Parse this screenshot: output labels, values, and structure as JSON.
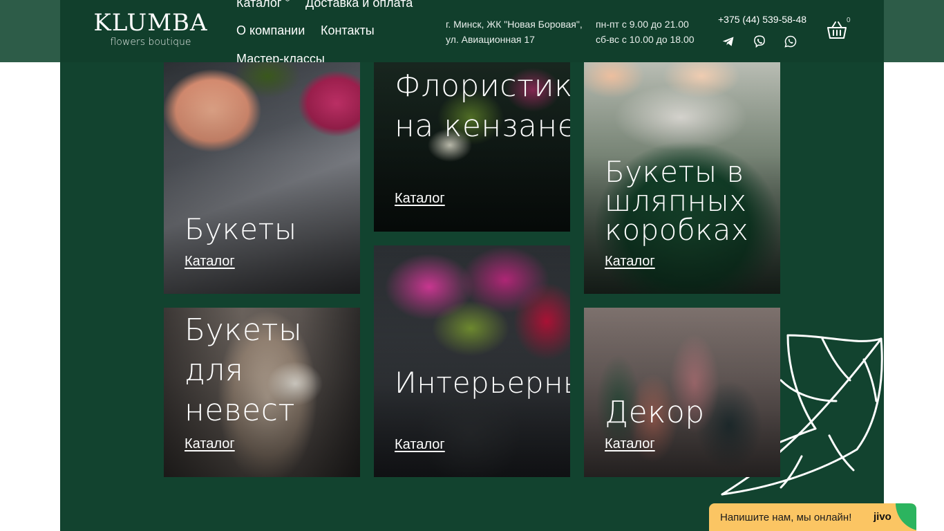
{
  "header": {
    "logo": {
      "main": "KLUMBA",
      "sub": "flowers boutique"
    },
    "nav": [
      {
        "label": "Каталог"
      },
      {
        "label": "Доставка и оплата"
      },
      {
        "label": "О компании"
      },
      {
        "label": "Контакты"
      },
      {
        "label": "Мастер-классы"
      }
    ],
    "address": {
      "line1": "г. Минск, ЖК \"Новая Боровая\",",
      "line2": "ул. Авиационная 17"
    },
    "hours": {
      "line1": "пн-пт с 9.00 до 21.00",
      "line2": "сб-вс с 10.00 до 18.00"
    },
    "phone": "+375 (44) 539-58-48",
    "socials": [
      "telegram-icon",
      "viber-icon",
      "whatsapp-icon"
    ],
    "cart": {
      "icon": "basket-icon",
      "count": "0"
    }
  },
  "categories": [
    {
      "title": "Букеты",
      "link": "Каталог"
    },
    {
      "title": "Флористика на кензане",
      "link": "Каталог"
    },
    {
      "title": "Букеты в шляпных коробках",
      "link": "Каталог"
    },
    {
      "title": "Букеты для невест",
      "link": "Каталог"
    },
    {
      "title": "Интерьерные композиции",
      "link": "Каталог"
    },
    {
      "title": "Декор",
      "link": "Каталог"
    }
  ],
  "chat": {
    "text": "Напишите нам, мы онлайн!",
    "brand": "jivo"
  },
  "colors": {
    "background": "#12432f",
    "header": "#113f2c",
    "chat": "#fbc563",
    "chat_accent": "#2cb45f"
  }
}
